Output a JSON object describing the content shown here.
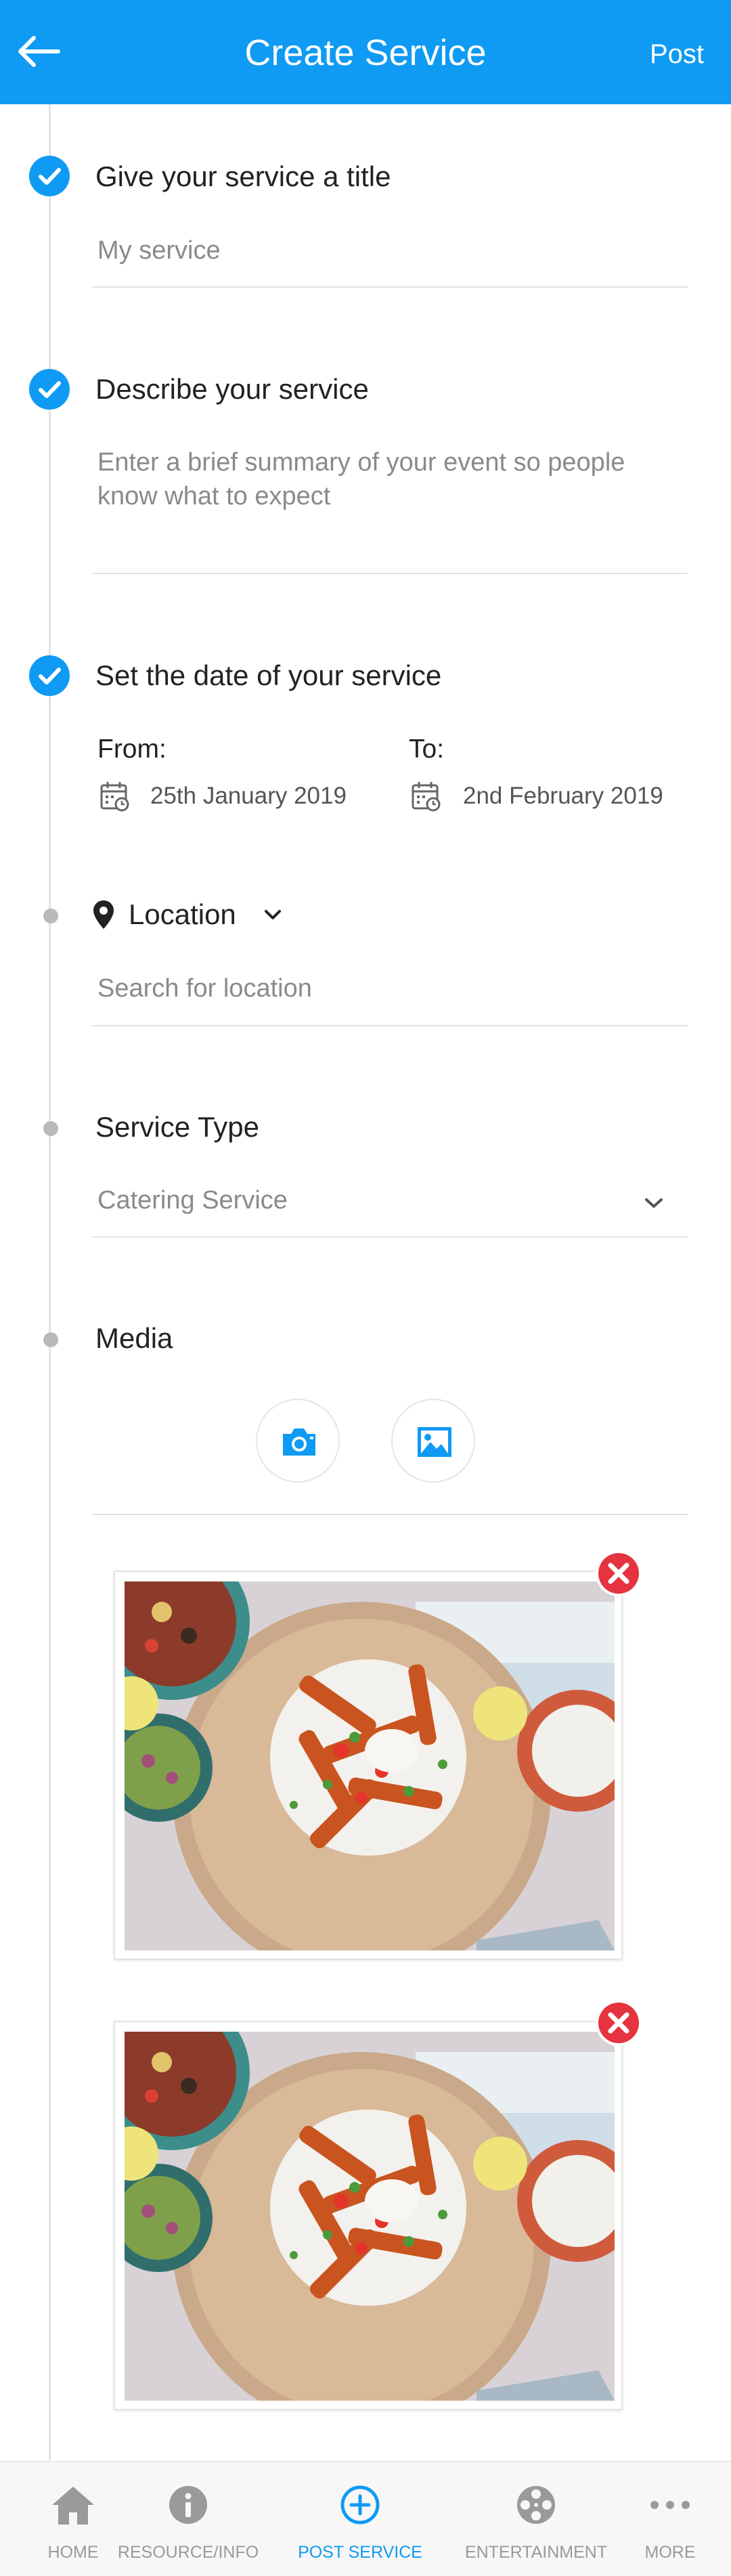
{
  "header": {
    "title": "Create Service",
    "post_label": "Post",
    "back_icon": "arrow-left-icon",
    "background_color": "#0f9af3"
  },
  "sections": {
    "title": {
      "heading": "Give your service a title",
      "value": "My service",
      "status": "complete"
    },
    "description": {
      "heading": "Describe your service",
      "placeholder": "Enter a brief summary of your event so people know what to expect",
      "status": "complete"
    },
    "date": {
      "heading": "Set the date of your service",
      "from_label": "From:",
      "from_value": "25th January 2019",
      "to_label": "To:",
      "to_value": "2nd February 2019",
      "status": "complete"
    },
    "location": {
      "heading": "Location",
      "placeholder": "Search for location",
      "status": "incomplete"
    },
    "service_type": {
      "heading": "Service Type",
      "selected": "Catering Service",
      "status": "incomplete"
    },
    "media": {
      "heading": "Media",
      "camera_icon": "camera-icon",
      "gallery_icon": "image-gallery-icon",
      "images": [
        {
          "description": "food-photo",
          "remove_icon": "remove-icon"
        },
        {
          "description": "food-photo",
          "remove_icon": "remove-icon"
        }
      ],
      "status": "incomplete"
    }
  },
  "bottom_nav": {
    "items": [
      {
        "label": "HOME",
        "icon": "home-icon",
        "active": false
      },
      {
        "label": "RESOURCE/INFO",
        "icon": "info-icon",
        "active": false
      },
      {
        "label": "POST SERVICE",
        "icon": "add-circle-icon",
        "active": true
      },
      {
        "label": "ENTERTAINMENT",
        "icon": "film-reel-icon",
        "active": false
      },
      {
        "label": "MORE",
        "icon": "more-dots-icon",
        "active": false
      }
    ]
  },
  "colors": {
    "accent": "#0f9af3",
    "remove": "#e53340",
    "inactive": "#9a9a9a"
  }
}
